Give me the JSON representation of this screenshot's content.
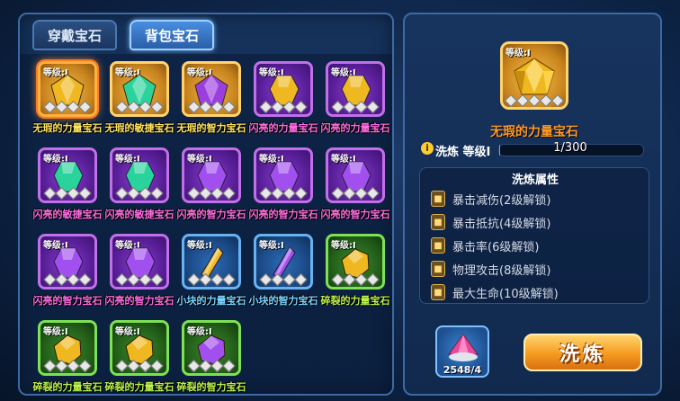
{
  "tabs": [
    {
      "label": "穿戴宝石",
      "active": false
    },
    {
      "label": "背包宝石",
      "active": true
    }
  ],
  "gems": [
    {
      "name": "无瑕的力量宝石",
      "level": "等级:I",
      "rarity": "gold",
      "gem_color": "#f0b820",
      "shape": "diamond",
      "selected": true
    },
    {
      "name": "无瑕的敏捷宝石",
      "level": "等级:I",
      "rarity": "gold",
      "gem_color": "#2ad39b",
      "shape": "diamond",
      "selected": false
    },
    {
      "name": "无瑕的智力宝石",
      "level": "等级:I",
      "rarity": "gold",
      "gem_color": "#9b3ee0",
      "shape": "diamond",
      "selected": false
    },
    {
      "name": "闪亮的力量宝石",
      "level": "等级:I",
      "rarity": "purple",
      "gem_color": "#f0b820",
      "shape": "hex",
      "selected": false
    },
    {
      "name": "闪亮的力量宝石",
      "level": "等级:I",
      "rarity": "purple",
      "gem_color": "#f0b820",
      "shape": "hex",
      "selected": false
    },
    {
      "name": "闪亮的敏捷宝石",
      "level": "等级:I",
      "rarity": "purple",
      "gem_color": "#2ad39b",
      "shape": "hex",
      "selected": false
    },
    {
      "name": "闪亮的敏捷宝石",
      "level": "等级:I",
      "rarity": "purple",
      "gem_color": "#2ad39b",
      "shape": "hex",
      "selected": false
    },
    {
      "name": "闪亮的智力宝石",
      "level": "等级:I",
      "rarity": "purple",
      "gem_color": "#a24ff0",
      "shape": "hex",
      "selected": false
    },
    {
      "name": "闪亮的智力宝石",
      "level": "等级:I",
      "rarity": "purple",
      "gem_color": "#a24ff0",
      "shape": "hex",
      "selected": false
    },
    {
      "name": "闪亮的智力宝石",
      "level": "等级:I",
      "rarity": "purple",
      "gem_color": "#a24ff0",
      "shape": "hex",
      "selected": false
    },
    {
      "name": "闪亮的智力宝石",
      "level": "等级:I",
      "rarity": "purple",
      "gem_color": "#a24ff0",
      "shape": "hex",
      "selected": false
    },
    {
      "name": "闪亮的智力宝石",
      "level": "等级:I",
      "rarity": "purple",
      "gem_color": "#a24ff0",
      "shape": "hex",
      "selected": false
    },
    {
      "name": "小块的力量宝石",
      "level": "等级:I",
      "rarity": "blue",
      "gem_color": "#f0b820",
      "shape": "shard",
      "selected": false
    },
    {
      "name": "小块的智力宝石",
      "level": "等级:I",
      "rarity": "blue",
      "gem_color": "#a24ff0",
      "shape": "shard",
      "selected": false
    },
    {
      "name": "碎裂的力量宝石",
      "level": "等级:I",
      "rarity": "green",
      "gem_color": "#f0b820",
      "shape": "round",
      "selected": false
    },
    {
      "name": "碎裂的力量宝石",
      "level": "等级:I",
      "rarity": "green",
      "gem_color": "#f0b820",
      "shape": "round",
      "selected": false
    },
    {
      "name": "碎裂的力量宝石",
      "level": "等级:I",
      "rarity": "green",
      "gem_color": "#f0b820",
      "shape": "round",
      "selected": false
    },
    {
      "name": "碎裂的智力宝石",
      "level": "等级:I",
      "rarity": "green",
      "gem_color": "#a24ff0",
      "shape": "round",
      "selected": false
    }
  ],
  "detail": {
    "level": "等级:I",
    "name": "无瑕的力量宝石",
    "refine_level_label": "洗炼 等级I",
    "progress_text": "1/300",
    "progress_fraction": 0.0033,
    "attr_title": "洗炼属性",
    "attributes": [
      "暴击减伤(2级解锁)",
      "暴击抵抗(4级解锁)",
      "暴击率(6级解锁)",
      "物理攻击(8级解锁)",
      "最大生命(10级解锁)"
    ],
    "material_count": "2548/4",
    "refine_button": "洗炼"
  },
  "colors": {
    "gold_label": "#ffe35a",
    "purple_label": "#ff6be0",
    "blue_label": "#7ad3ff",
    "green_label": "#b9f24a",
    "name_orange": "#ff9a2a"
  }
}
